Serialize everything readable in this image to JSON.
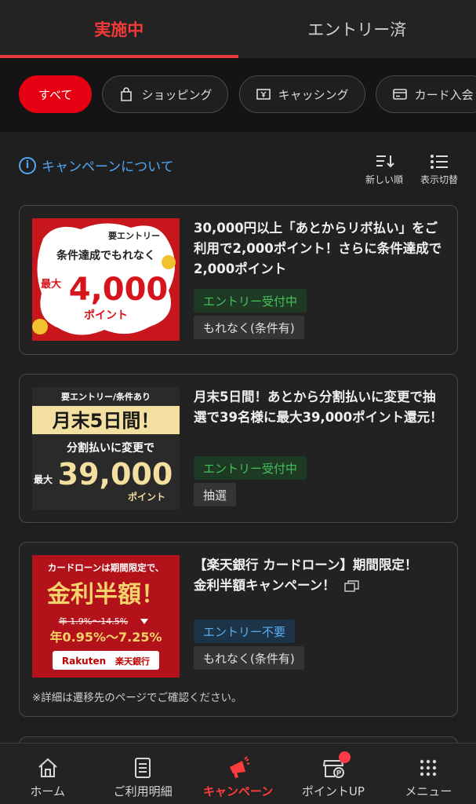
{
  "tabs": [
    {
      "label": "実施中",
      "active": true
    },
    {
      "label": "エントリー済",
      "active": false
    }
  ],
  "filters": [
    {
      "label": "すべて",
      "icon": "none",
      "active": true
    },
    {
      "label": "ショッピング",
      "icon": "shopping-bag-icon",
      "active": false
    },
    {
      "label": "キャッシング",
      "icon": "cash-icon",
      "active": false
    },
    {
      "label": "カード入会",
      "icon": "credit-card-icon",
      "active": false
    }
  ],
  "about": {
    "label": "キャンペーンについて",
    "icon": "info-icon"
  },
  "toolbar": {
    "sort_label": "新しい順",
    "view_label": "表示切替"
  },
  "campaigns": [
    {
      "title": "30,000円以上「あとからリボ払い」をご利用で2,000ポイント！さらに条件達成で2,000ポイント",
      "status": "エントリー受付中",
      "tag": "もれなく(条件有)",
      "banner": {
        "line1": "要エントリー",
        "line2": "条件達成でもれなく",
        "prefix": "最大",
        "amount": "4,000",
        "unit": "ポイント"
      }
    },
    {
      "title": "月末5日間！あとから分割払いに変更で抽選で39名様に最大39,000ポイント還元！",
      "status": "エントリー受付中",
      "tag": "抽選",
      "banner": {
        "line1": "要エントリー/条件あり",
        "line2": "月末5日間！",
        "line3": "分割払いに変更で",
        "prefix": "最大",
        "amount": "39,000",
        "unit": "ポイント"
      }
    },
    {
      "title": "【楽天銀行 カードローン】期間限定！金利半額キャンペーン！",
      "status": "エントリー不要",
      "tag": "もれなく(条件有)",
      "note": "※詳細は遷移先のページでご確認ください。",
      "banner": {
        "line1": "カードローンは期間限定で、",
        "line2": "金利半額！",
        "old_rate": "年 1.9%〜14.5%",
        "new_rate": "年0.95%〜7.25%",
        "brand": "Rakuten",
        "bank": "楽天銀行"
      }
    }
  ],
  "nav": [
    {
      "label": "ホーム",
      "icon": "home-icon",
      "active": false
    },
    {
      "label": "ご利用明細",
      "icon": "statement-icon",
      "active": false
    },
    {
      "label": "キャンペーン",
      "icon": "megaphone-icon",
      "active": true
    },
    {
      "label": "ポイントUP",
      "icon": "store-points-icon",
      "active": false,
      "notification": true
    },
    {
      "label": "メニュー",
      "icon": "grid-menu-icon",
      "active": false
    }
  ],
  "colors": {
    "accent": "#e60012",
    "link": "#52a6ef",
    "status_green": "#46c05a",
    "status_blue": "#5aaeef",
    "background": "#1f1f1f"
  }
}
